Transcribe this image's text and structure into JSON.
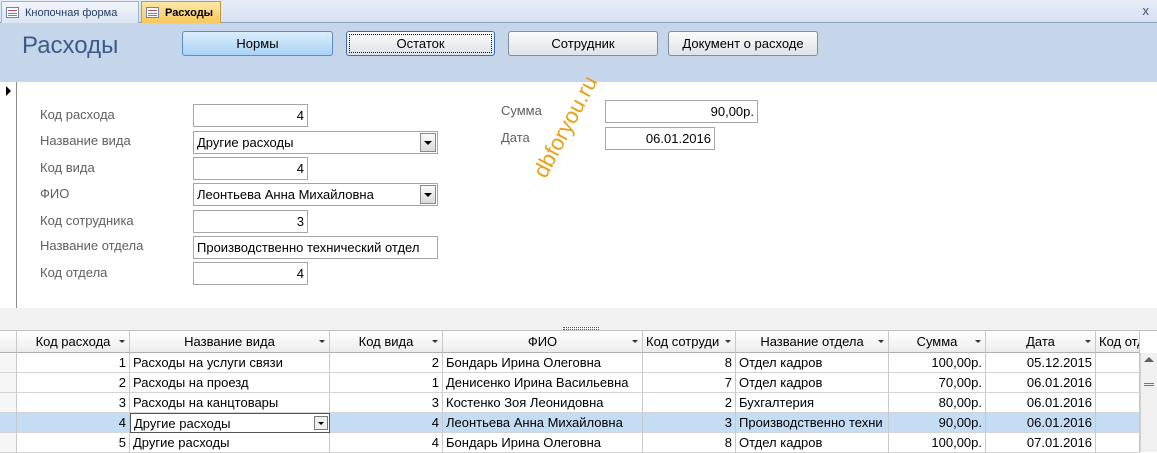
{
  "tabs": [
    {
      "label": "Кнопочная форма",
      "active": false
    },
    {
      "label": "Расходы",
      "active": true
    }
  ],
  "close_label": "x",
  "header": {
    "title": "Расходы",
    "buttons": [
      "Нормы",
      "Остаток",
      "Сотрудник",
      "Документ о расходе"
    ]
  },
  "form": {
    "fields": [
      {
        "label": "Код расхода",
        "value": "4"
      },
      {
        "label": "Название вида",
        "value": "Другие расходы"
      },
      {
        "label": "Код вида",
        "value": "4"
      },
      {
        "label": "ФИО",
        "value": "Леонтьева Анна Михайловна"
      },
      {
        "label": "Код сотрудника",
        "value": "3"
      },
      {
        "label": "Название отдела",
        "value": "Производственно технический отдел"
      },
      {
        "label": "Код отдела",
        "value": "4"
      }
    ],
    "right_fields": [
      {
        "label": "Сумма",
        "value": "90,00р."
      },
      {
        "label": "Дата",
        "value": "06.01.2016"
      }
    ]
  },
  "watermark": "dbforyou.ru",
  "grid": {
    "columns": [
      "Код расхода",
      "Название вида",
      "Код вида",
      "ФИО",
      "Код сотруди",
      "Название отдела",
      "Сумма",
      "Дата",
      "Код отд"
    ],
    "rows": [
      [
        "1",
        "Расходы на услуги связи",
        "2",
        "Бондарь Ирина Олеговна",
        "8",
        "Отдел кадров",
        "100,00р.",
        "05.12.2015"
      ],
      [
        "2",
        "Расходы на проезд",
        "1",
        "Денисенко Ирина Васильевна",
        "7",
        "Отдел кадров",
        "70,00р.",
        "06.01.2016"
      ],
      [
        "3",
        "Расходы на канцтовары",
        "3",
        "Костенко Зоя Леонидовна",
        "2",
        "Бухгалтерия",
        "80,00р.",
        "06.01.2016"
      ],
      [
        "4",
        "Другие расходы",
        "4",
        "Леонтьева Анна Михайловна",
        "3",
        "Производственно техни",
        "90,00р.",
        "06.01.2016"
      ],
      [
        "5",
        "Другие расходы",
        "4",
        "Бондарь Ирина Олеговна",
        "8",
        "Отдел кадров",
        "100,00р.",
        "07.01.2016"
      ]
    ],
    "selected_row": 3
  }
}
